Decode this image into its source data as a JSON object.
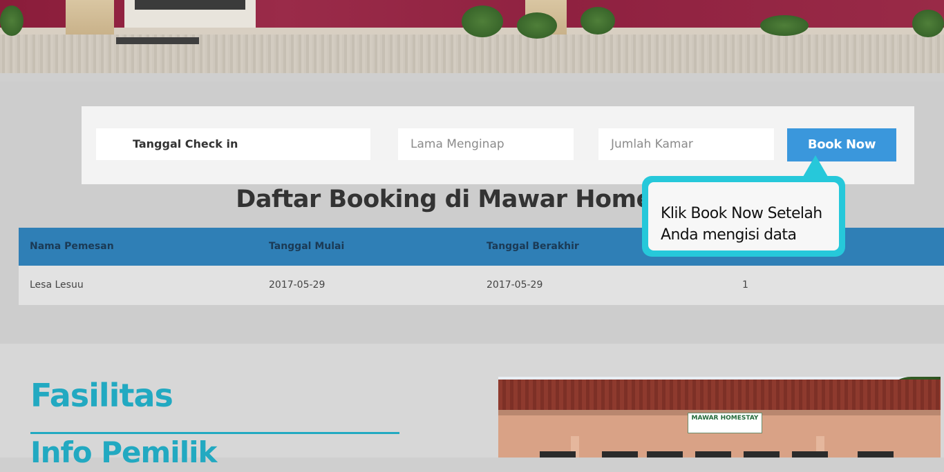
{
  "booking_form": {
    "checkin_value": "Tanggal Check in",
    "lama_placeholder": "Lama Menginap",
    "jumlah_placeholder": "Jumlah Kamar",
    "book_button": "Book Now"
  },
  "tooltip": {
    "line1": "Klik Book Now Setelah",
    "line2": "Anda mengisi data"
  },
  "list_title": "Daftar Booking di Mawar Homestay",
  "table": {
    "headers": [
      "Nama Pemesan",
      "Tanggal Mulai",
      "Tanggal Berakhir",
      ""
    ],
    "rows": [
      [
        "Lesa Lesuu",
        "2017-05-29",
        "2017-05-29",
        "1"
      ]
    ]
  },
  "sections": {
    "fasilitas": "Fasilitas",
    "info_pemilik": "Info Pemilik"
  },
  "house_photo": {
    "sign_text": "MAWAR HOMESTAY"
  },
  "colors": {
    "accent": "#22a9c1",
    "button": "#3a97dc",
    "table_header": "#2f7fb6",
    "tooltip": "#26c8da"
  }
}
